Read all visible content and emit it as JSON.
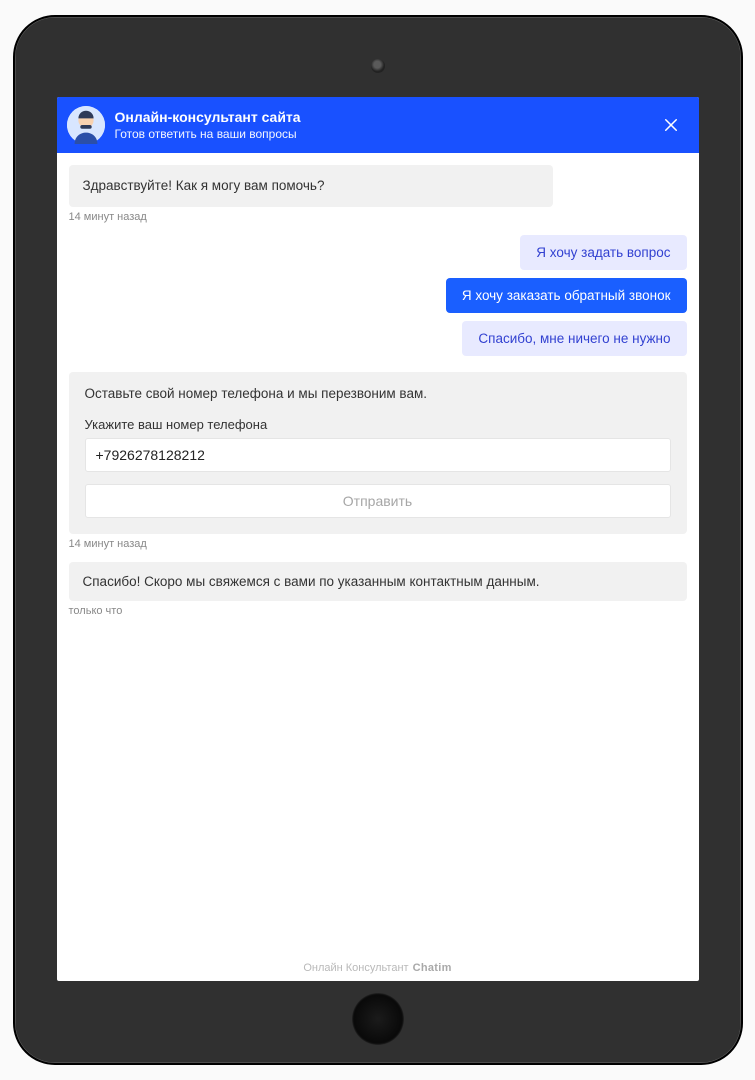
{
  "header": {
    "title": "Онлайн-консультант сайта",
    "subtitle": "Готов ответить на ваши вопросы"
  },
  "messages": {
    "greeting": "Здравствуйте! Как я могу вам помочь?",
    "greeting_time": "14 минут назад",
    "thanks": "Спасибо! Скоро мы свяжемся с вами по указанным контактным данным.",
    "thanks_time": "только что"
  },
  "quick_replies": {
    "ask": "Я хочу задать вопрос",
    "callback": "Я хочу заказать обратный звонок",
    "nothing": "Спасибо, мне ничего не нужно"
  },
  "form": {
    "intro": "Оставьте свой номер телефона и мы перезвоним вам.",
    "label": "Укажите ваш номер телефона",
    "value": "+7926278128212",
    "submit": "Отправить",
    "time": "14 минут назад"
  },
  "footer": {
    "text": "Онлайн Консультант",
    "brand": "Chatim"
  }
}
